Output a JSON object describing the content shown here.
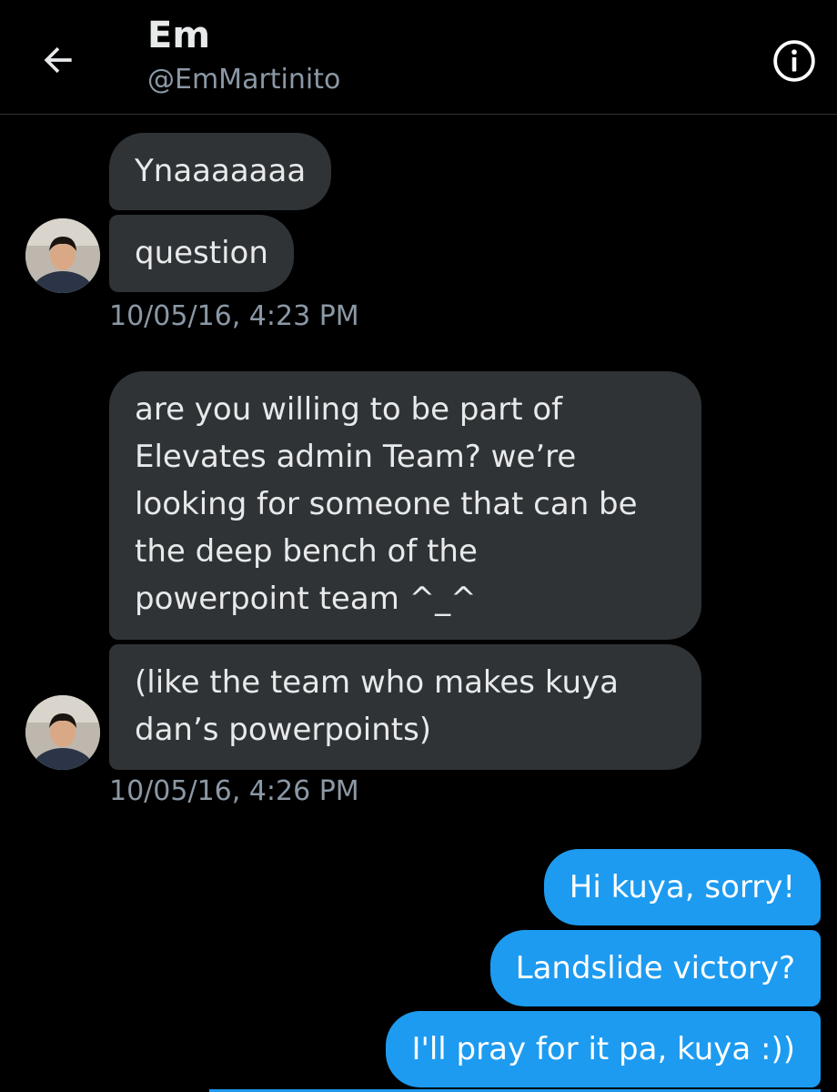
{
  "header": {
    "display_name": "Em",
    "handle": "@EmMartinito",
    "back_icon": "arrow-left-icon",
    "info_icon": "info-circle-icon"
  },
  "messages": [
    {
      "direction": "incoming",
      "text": "Ynaaaaaaa"
    },
    {
      "direction": "incoming",
      "text": "question"
    },
    {
      "direction": "incoming",
      "text": "are you willing to be part of\nElevates admin Team? we’re\nlooking for someone that can be\nthe deep bench of the\npowerpoint team ^_^"
    },
    {
      "direction": "incoming",
      "text": "(like the team who makes kuya\ndan’s powerpoints)"
    },
    {
      "direction": "outgoing",
      "text": "Hi kuya, sorry!"
    },
    {
      "direction": "outgoing",
      "text": "Landslide victory?"
    },
    {
      "direction": "outgoing",
      "text": "I'll pray for it pa, kuya :))"
    }
  ],
  "timestamps": [
    "10/05/16, 4:23 PM",
    "10/05/16, 4:26 PM"
  ],
  "colors": {
    "background": "#000000",
    "incoming_bubble": "#2f3336",
    "outgoing_bubble": "#1d9bf0",
    "secondary_text": "#8b98a5"
  }
}
